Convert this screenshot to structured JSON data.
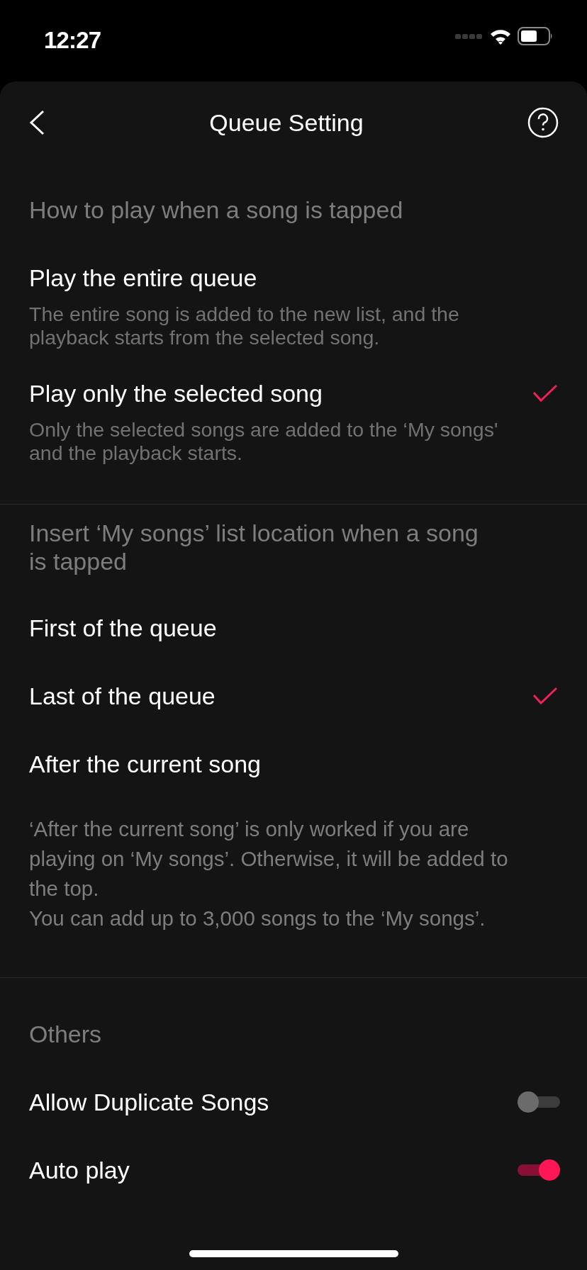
{
  "status_bar": {
    "time": "12:27"
  },
  "header": {
    "title": "Queue Setting"
  },
  "sections": [
    {
      "heading": "How to play when a song is tapped",
      "items": [
        {
          "kind": "option",
          "title": "Play the entire queue",
          "description": "The entire song is added to the new list, and the playback starts from the selected song.",
          "selected": false
        },
        {
          "kind": "option",
          "title": "Play only the selected song",
          "description": "Only the selected songs are added to the ‘My songs' and the playback starts.",
          "selected": true
        }
      ]
    },
    {
      "heading": "Insert ‘My songs’ list location when a song is tapped",
      "items": [
        {
          "kind": "option",
          "title": "First of the queue",
          "selected": false
        },
        {
          "kind": "option",
          "title": "Last of the queue",
          "selected": true
        },
        {
          "kind": "option",
          "title": "After the current song",
          "selected": false
        }
      ],
      "note": [
        "‘After the current song’ is only worked if you are playing on ‘My songs’. Otherwise, it will be added to the top.",
        "You can add up to 3,000 songs to the ‘My songs’."
      ]
    },
    {
      "heading": "Others",
      "items": [
        {
          "kind": "toggle",
          "title": "Allow Duplicate Songs",
          "on": false
        },
        {
          "kind": "toggle",
          "title": "Auto play",
          "on": true
        }
      ]
    }
  ]
}
